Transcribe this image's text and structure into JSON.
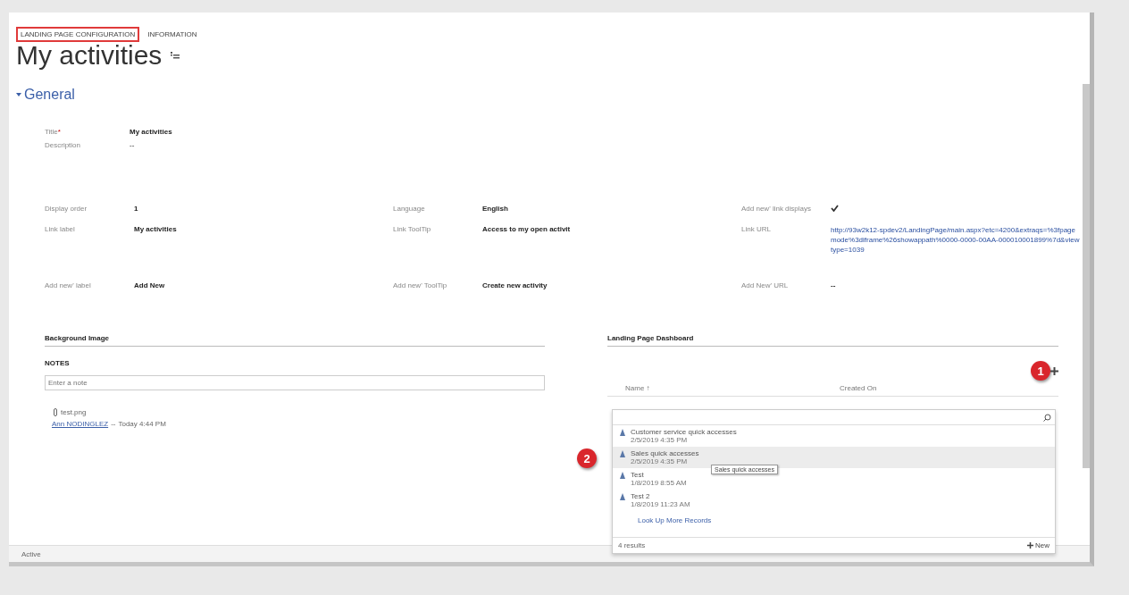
{
  "tabs": [
    {
      "label": "LANDING PAGE CONFIGURATION",
      "selected": true
    },
    {
      "label": "INFORMATION",
      "selected": false
    }
  ],
  "title": "My activities",
  "section": {
    "label": "General",
    "expanded": true
  },
  "title_fields": [
    {
      "label": "Title",
      "marker": "*",
      "value": "My activities"
    },
    {
      "label": "Description",
      "value": "--"
    }
  ],
  "field_rows": [
    [
      {
        "label": "Display order",
        "kind": "text",
        "value": "1"
      },
      {
        "label": "Language",
        "kind": "text",
        "value": "English"
      },
      {
        "label": "Add new' link displays",
        "kind": "checkbox",
        "checked": true
      }
    ],
    [
      {
        "label": "Link label",
        "kind": "text",
        "value": "My activities"
      },
      {
        "label": "Link ToolTip",
        "kind": "text",
        "value": "Access to my open activit"
      },
      {
        "label": "Link URL",
        "kind": "link",
        "value": "http://93w2k12-spdev2/LandingPage/main.aspx?etc=4200&extraqs=%3fpagemode%3diframe%26showappath%0000-0000-00AA-000010001899%7d&viewtype=1039"
      }
    ],
    [
      {
        "label": "Add new' label",
        "kind": "text",
        "value": "Add New"
      },
      {
        "label": "Add new' ToolTip",
        "kind": "text",
        "value": "Create new activity"
      },
      {
        "label": "Add New' URL",
        "kind": "text",
        "value": "--"
      }
    ]
  ],
  "background_image": {
    "heading": "Background Image"
  },
  "notes": {
    "heading": "NOTES",
    "placeholder": "Enter a note",
    "attachment": "test.png",
    "author": "Ann NODINGLEZ",
    "separator": "--",
    "time": "Today 4:44 PM"
  },
  "dashboard": {
    "heading": "Landing Page Dashboard",
    "badge": "1",
    "columns": [
      "Name ↑",
      "Created On"
    ],
    "lookup": {
      "items": [
        {
          "name": "Customer service quick accesses",
          "date": "2/5/2019 4:35 PM",
          "selected": false
        },
        {
          "name": "Sales quick accesses",
          "date": "2/5/2019 4:35 PM",
          "selected": true
        },
        {
          "name": "Test",
          "date": "1/8/2019 8:55 AM",
          "selected": false
        },
        {
          "name": "Test 2",
          "date": "1/8/2019 11:23 AM",
          "selected": false
        }
      ],
      "badge": "2",
      "tooltip": "Sales quick accesses",
      "more": "Look Up More Records",
      "count": "4 results",
      "new_label": "New"
    }
  },
  "status_bar": "Active"
}
